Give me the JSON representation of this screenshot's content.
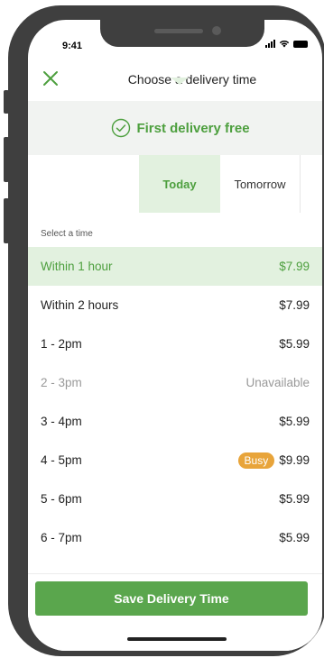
{
  "status_bar": {
    "time": "9:41"
  },
  "header": {
    "title": "Choose a delivery time"
  },
  "promo": {
    "text": "First delivery free"
  },
  "tabs": [
    {
      "label": "Today",
      "active": true
    },
    {
      "label": "Tomorrow",
      "active": false
    }
  ],
  "section_label": "Select a time",
  "slots": [
    {
      "label": "Within 1 hour",
      "price": "$7.99",
      "state": "selected"
    },
    {
      "label": "Within 2 hours",
      "price": "$7.99",
      "state": "normal"
    },
    {
      "label": "1 - 2pm",
      "price": "$5.99",
      "state": "normal"
    },
    {
      "label": "2 - 3pm",
      "price": "Unavailable",
      "state": "disabled"
    },
    {
      "label": "3 - 4pm",
      "price": "$5.99",
      "state": "normal"
    },
    {
      "label": "4 - 5pm",
      "price": "$9.99",
      "badge": "Busy",
      "state": "normal"
    },
    {
      "label": "5 - 6pm",
      "price": "$5.99",
      "state": "normal"
    },
    {
      "label": "6 - 7pm",
      "price": "$5.99",
      "state": "normal"
    }
  ],
  "footer": {
    "save_label": "Save Delivery Time"
  },
  "colors": {
    "accent": "#4d9f3e",
    "button": "#5aa64d",
    "selected_bg": "#e2f1df",
    "busy": "#e8a43a"
  },
  "icons": {
    "close": "close-icon",
    "promo": "check-circle-icon",
    "signal": "signal-icon",
    "wifi": "wifi-icon",
    "battery": "battery-icon"
  }
}
